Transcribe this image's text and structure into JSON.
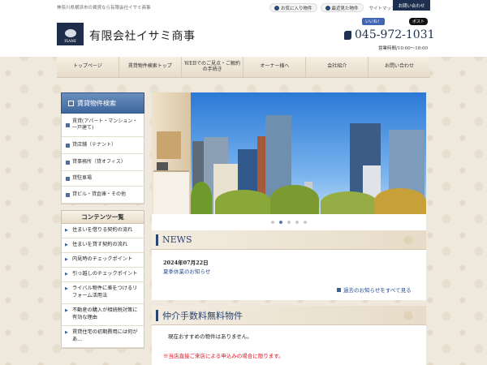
{
  "header": {
    "tagline": "神奈川県横浜市の賃貸なら有限会社イサミ商事",
    "favorites_label": "お気に入り物件",
    "recent_label": "最近見た物件",
    "sitemap_label": "サイトマップ",
    "contact_label": "お問い合わせ",
    "logo_text": "ISAMI",
    "company_name": "有限会社イサミ商事",
    "fb_label": "いいね！",
    "x_label": "ポスト",
    "phone": "045-972-1031",
    "hours": "営業時間/10:00～18:00"
  },
  "nav": {
    "items": [
      {
        "label": "トップページ"
      },
      {
        "label": "賃貸物件検索トップ"
      },
      {
        "label": "WEBでのご見点・ご解約の手続き"
      },
      {
        "label": "オーナー様へ"
      },
      {
        "label": "会社紹介"
      },
      {
        "label": "お問い合わせ"
      }
    ]
  },
  "sidebar": {
    "search_title": "賃貸物件検索",
    "items": [
      {
        "label": "賃貸(アパート・マンション・一戸建て)"
      },
      {
        "label": "貸店舗（テナント）"
      },
      {
        "label": "貸事務所（貸オフィス）"
      },
      {
        "label": "貸駐車場"
      },
      {
        "label": "貸ビル・貸倉庫・その他"
      }
    ],
    "contents_title": "コンテンツ一覧",
    "contents": [
      {
        "label": "住まいを借りる契約の流れ"
      },
      {
        "label": "住まいを貸す契約の流れ"
      },
      {
        "label": "内見時のチェックポイント"
      },
      {
        "label": "引っ越しのチェックポイント"
      },
      {
        "label": "ライバル物件に差をつけるリフォーム活用法"
      },
      {
        "label": "不動産の購入が相続税対策に有効な理由"
      },
      {
        "label": "賃貸住宅の初期費用には何があ..."
      }
    ]
  },
  "slider": {
    "active_index": 1,
    "dot_count": 5
  },
  "news": {
    "title": "NEWS",
    "date": "2024年07月22日",
    "link": "夏季休業のお知らせ",
    "more": "過去のお知らせをすべて見る"
  },
  "free": {
    "title": "仲介手数料無料物件",
    "text": "現在おすすめの物件はありません。",
    "note": "※当店直接ご来店による申込みの場合に限ります。"
  },
  "colors": {
    "navy": "#1e3050",
    "accent_blue": "#3f679e",
    "link": "#2a4f9a",
    "alert": "#dd1122"
  }
}
